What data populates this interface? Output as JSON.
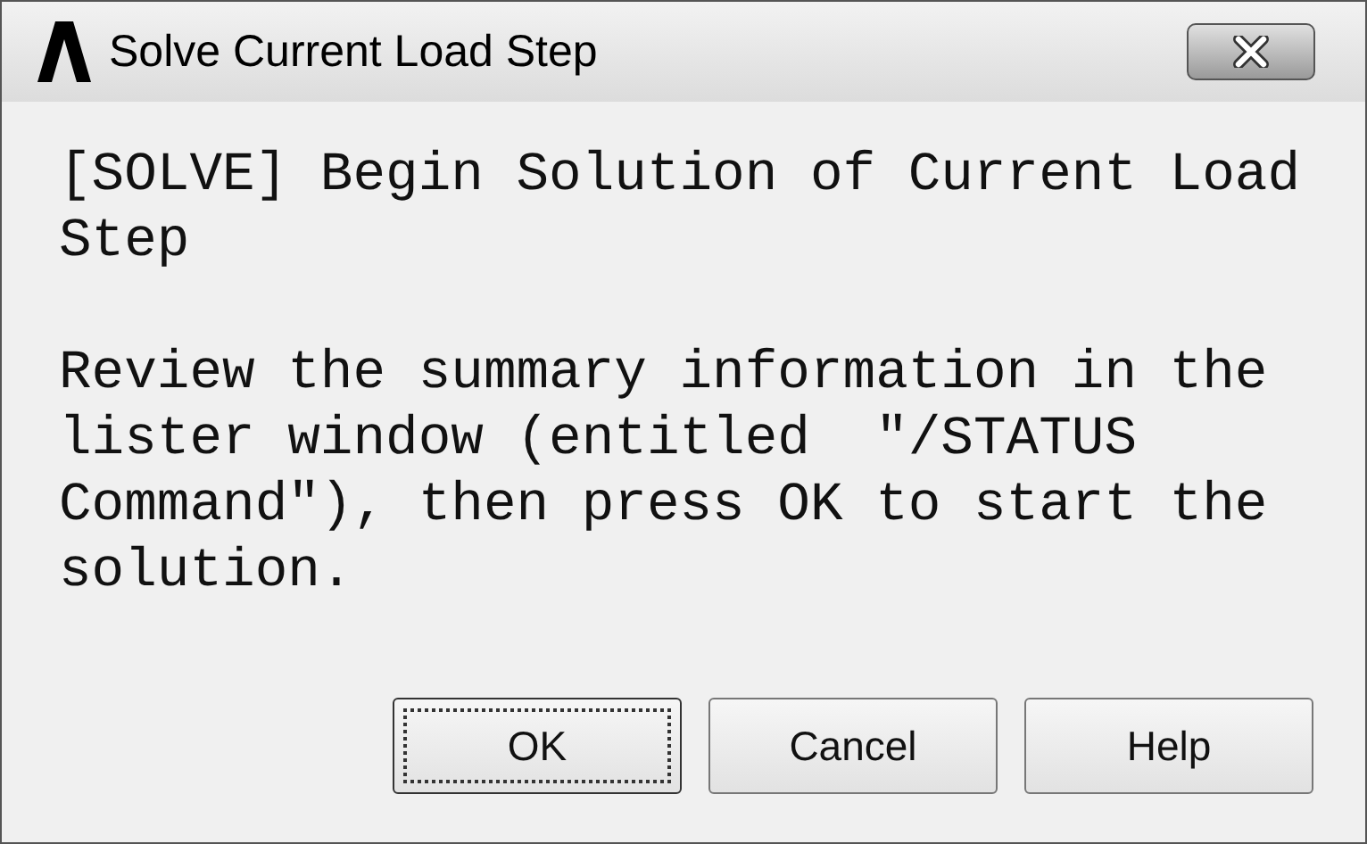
{
  "window": {
    "title": "Solve Current Load Step"
  },
  "paragraphs": [
    "[SOLVE] Begin Solution of Current Load Step",
    "Review the summary information in the lister window (entitled  ″/STATUS Command″), then press OK to start the solution."
  ],
  "buttons": [
    {
      "label": "OK",
      "focused": true
    },
    {
      "label": "Cancel",
      "focused": false
    },
    {
      "label": "Help",
      "focused": false
    }
  ]
}
